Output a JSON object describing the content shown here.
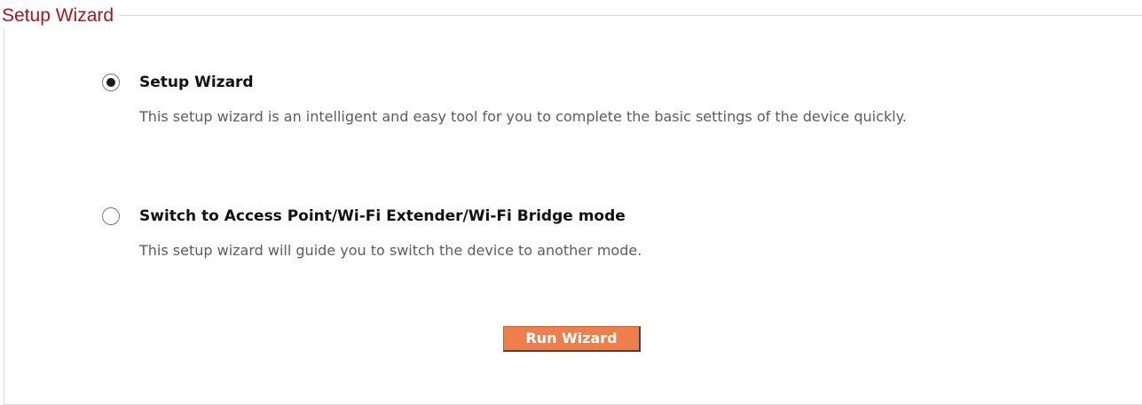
{
  "section": {
    "title": "Setup Wizard"
  },
  "options": [
    {
      "label": "Setup Wizard",
      "description": "This setup wizard is an intelligent and easy tool for you to complete the basic settings of the device quickly.",
      "selected": true
    },
    {
      "label": "Switch to Access Point/Wi-Fi Extender/Wi-Fi Bridge mode",
      "description": "This setup wizard will guide you to switch the device to another mode.",
      "selected": false
    }
  ],
  "actions": {
    "run_label": "Run Wizard"
  },
  "colors": {
    "title": "#a8161b",
    "button": "#ef7f4a",
    "border": "#d6d6d6"
  },
  "icons": {
    "selected_radio": "radio-selected-icon",
    "unselected_radio": "radio-unselected-icon"
  }
}
